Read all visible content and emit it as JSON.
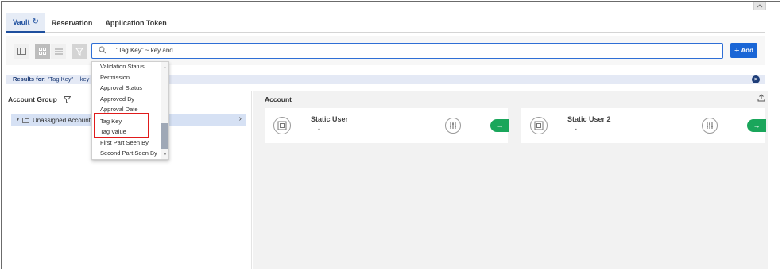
{
  "tabs": [
    {
      "label": "Vault",
      "icon": "refresh-icon",
      "active": true
    },
    {
      "label": "Reservation",
      "active": false
    },
    {
      "label": "Application Token",
      "active": false
    }
  ],
  "search": {
    "value": "\"Tag Key\" ~ key and"
  },
  "add_button": {
    "label": "Add"
  },
  "results": {
    "label": "Results for:",
    "query": "\"Tag Key\" ~ key"
  },
  "left_panel": {
    "title": "Account Group",
    "tree_item": "Unassigned Accounts"
  },
  "right_panel": {
    "title": "Account",
    "cards": [
      {
        "title": "Static User",
        "subtitle": "-"
      },
      {
        "title": "Static User 2",
        "subtitle": "-"
      }
    ]
  },
  "dropdown": {
    "items": [
      "Validation Status",
      "Permission",
      "Approval Status",
      "Approved By",
      "Approval Date",
      "Tag Key",
      "Tag Value",
      "First Part Seen By",
      "Second Part Seen By"
    ],
    "scroll_fraction": 0.75
  },
  "colors": {
    "accent": "#1a66d6",
    "highlight": "#e01b1b",
    "go_button": "#1aa65b"
  }
}
